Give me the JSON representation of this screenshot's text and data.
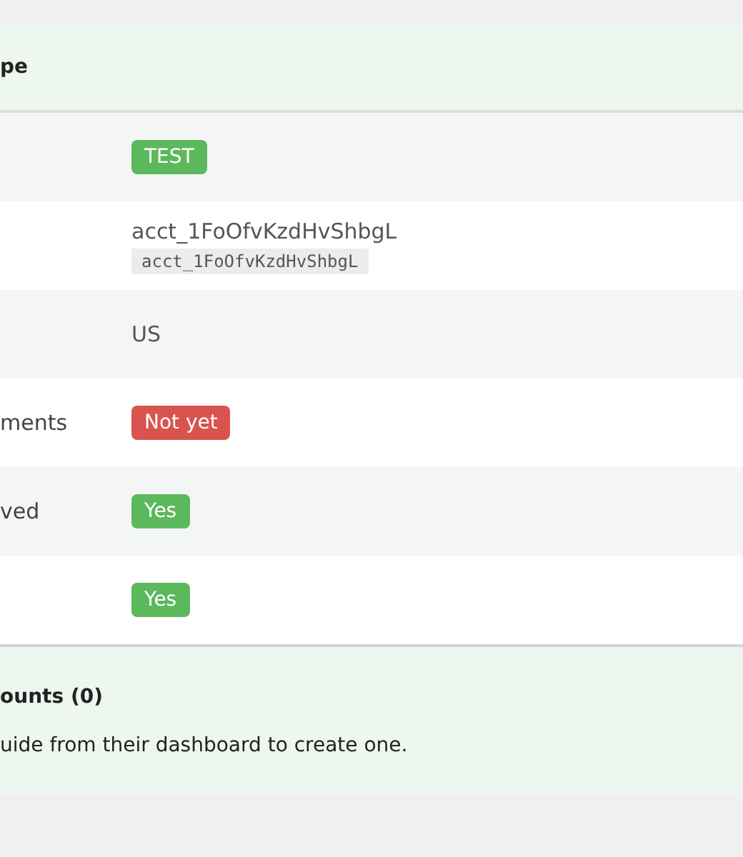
{
  "header": {
    "title": "pe"
  },
  "rows": [
    {
      "kind": "badge",
      "badge": {
        "text": "TEST",
        "color": "#5cb85c"
      }
    },
    {
      "kind": "id",
      "value": "acct_1FoOfvKzdHvShbgL",
      "code": "acct_1FoOfvKzdHvShbgL"
    },
    {
      "kind": "text",
      "value": "US"
    },
    {
      "kind": "badge",
      "label": "ments",
      "badge": {
        "text": "Not yet",
        "color": "#d9534f"
      }
    },
    {
      "kind": "badge",
      "label": "ved",
      "badge": {
        "text": "Yes",
        "color": "#5cb85c"
      }
    },
    {
      "kind": "badge",
      "badge": {
        "text": "Yes",
        "color": "#5cb85c"
      }
    }
  ],
  "footer": {
    "title": "ounts (0)",
    "text": "uide from their dashboard to create one."
  }
}
